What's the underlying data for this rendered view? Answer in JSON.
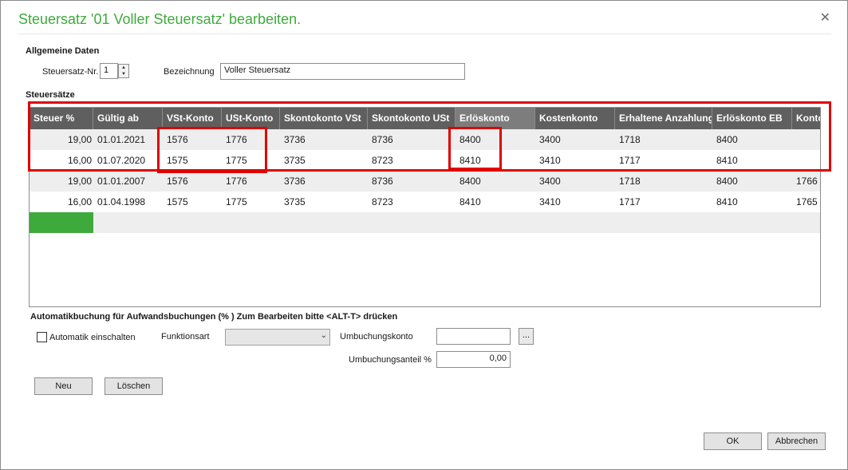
{
  "window": {
    "title": "Steuersatz '01 Voller Steuersatz' bearbeiten.",
    "close_glyph": "✕"
  },
  "general": {
    "section_label": "Allgemeine Daten",
    "nr_label": "Steuersatz-Nr.",
    "nr_value": "1",
    "bez_label": "Bezeichnung",
    "bez_value": "Voller Steuersatz"
  },
  "rates": {
    "section_label": "Steuersätze",
    "columns": [
      "Steuer %",
      "Gültig ab",
      "VSt-Konto",
      "USt-Konto",
      "Skontokonto VSt",
      "Skontokonto USt",
      "Erlöskonto",
      "Kostenkonto",
      "Erhaltene Anzahlungen",
      "Erlöskonto EB",
      "Konto"
    ],
    "rows": [
      [
        "19,00",
        "01.01.2021",
        "1576",
        "1776",
        "3736",
        "8736",
        "8400",
        "3400",
        "1718",
        "8400",
        ""
      ],
      [
        "16,00",
        "01.07.2020",
        "1575",
        "1775",
        "3735",
        "8723",
        "8410",
        "3410",
        "1717",
        "8410",
        ""
      ],
      [
        "19,00",
        "01.01.2007",
        "1576",
        "1776",
        "3736",
        "8736",
        "8400",
        "3400",
        "1718",
        "8400",
        "1766"
      ],
      [
        "16,00",
        "01.04.1998",
        "1575",
        "1775",
        "3735",
        "8723",
        "8410",
        "3410",
        "1717",
        "8410",
        "1765"
      ]
    ]
  },
  "auto": {
    "section_label": "Automatikbuchung für Aufwandsbuchungen (% )  Zum Bearbeiten bitte <ALT-T> drücken",
    "checkbox_label": "Automatik einschalten",
    "funktionsart_label": "Funktionsart",
    "funktionsart_value": "",
    "umbuchungskonto_label": "Umbuchungskonto",
    "umbuchungskonto_value": "",
    "lookup_label": "...",
    "anteil_label": "Umbuchungsanteil %",
    "anteil_value": "0,00"
  },
  "buttons": {
    "new": "Neu",
    "delete": "Löschen",
    "ok": "OK",
    "cancel": "Abbrechen"
  },
  "colors": {
    "accent": "#3faa3c",
    "header": "#5f5f5f",
    "highlight": "#e00000"
  }
}
